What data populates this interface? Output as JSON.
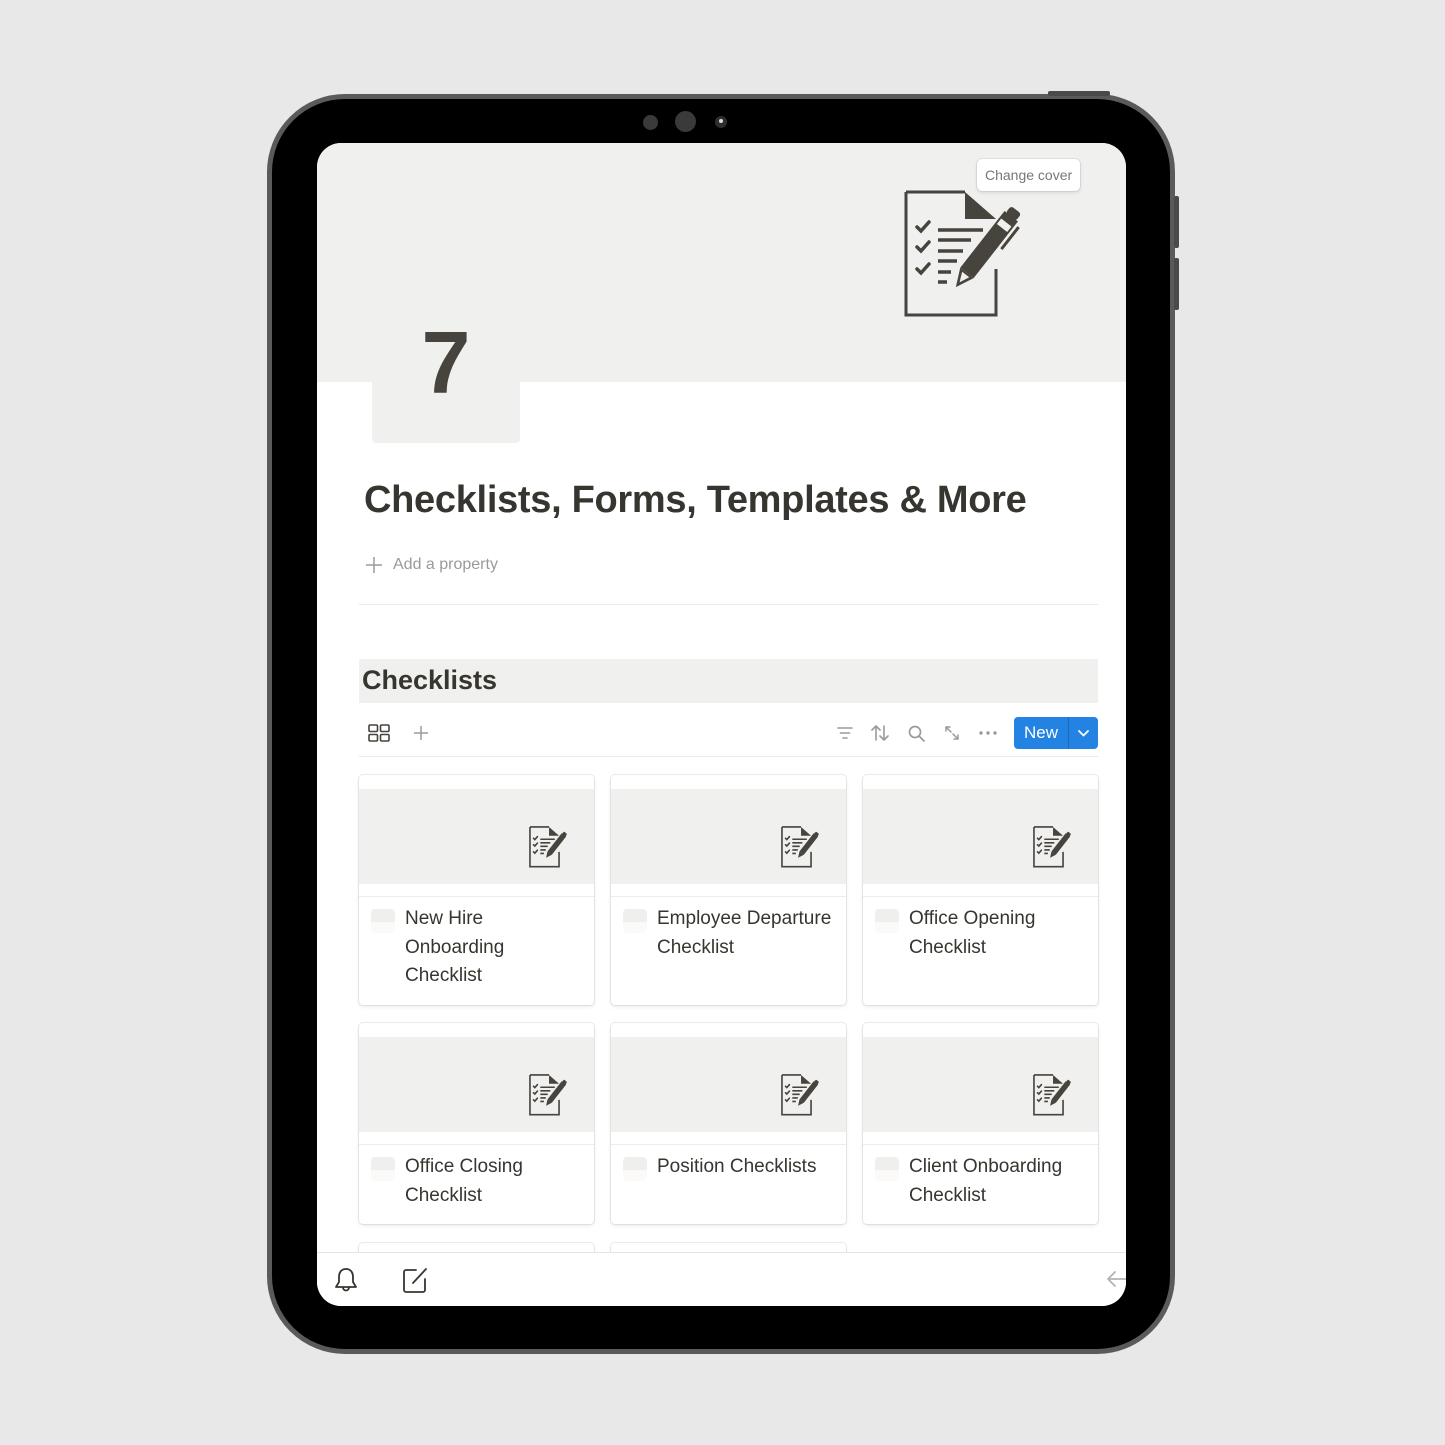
{
  "cover": {
    "change_cover_label": "Change cover",
    "art_icon": "checklist-pencil-icon"
  },
  "page": {
    "icon_glyph": "7",
    "title": "Checklists, Forms, Templates & More",
    "add_property_label": "Add a property"
  },
  "database": {
    "title": "Checklists",
    "view_icon": "gallery-grid-icon",
    "toolbar": {
      "icons": [
        "filter-icon",
        "sort-icon",
        "search-icon",
        "expand-icon",
        "more-icon"
      ],
      "new_label": "New"
    },
    "cards": [
      {
        "title": "New Hire Onboarding Checklist"
      },
      {
        "title": "Employee Departure Checklist"
      },
      {
        "title": "Office Opening Checklist"
      },
      {
        "title": "Office Closing Checklist"
      },
      {
        "title": "Position Checklists"
      },
      {
        "title": "Client Onboarding Checklist"
      }
    ]
  },
  "bottom_bar": {
    "icons": [
      "bell-icon",
      "compose-icon",
      "back-arrow-icon"
    ]
  },
  "colors": {
    "accent": "#2383e2",
    "text": "#37352f",
    "muted": "#9b9a97",
    "cover_bg": "#f0f0ef"
  }
}
